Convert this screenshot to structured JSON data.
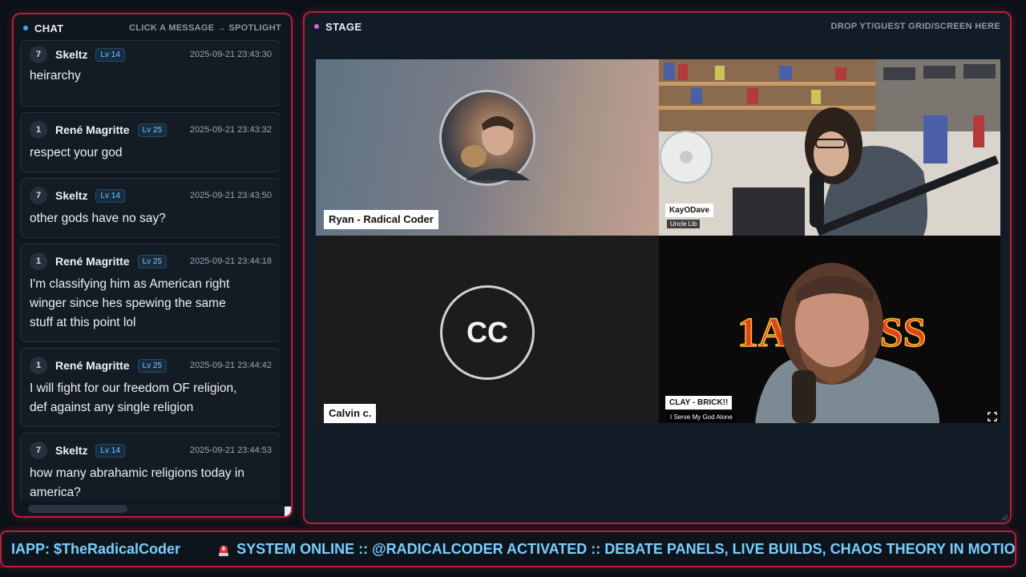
{
  "chat": {
    "title": "CHAT",
    "hint": "CLICK A MESSAGE → SPOTLIGHT",
    "messages": [
      {
        "rank": "7",
        "user": "Skeltz",
        "level": "Lv 14",
        "time": "2025-09-21 23:43:30",
        "lines": [
          "heirarchy"
        ]
      },
      {
        "rank": "1",
        "user": "René Magritte",
        "level": "Lv 25",
        "time": "2025-09-21 23:43:32",
        "lines": [
          "respect your god"
        ]
      },
      {
        "rank": "7",
        "user": "Skeltz",
        "level": "Lv 14",
        "time": "2025-09-21 23:43:50",
        "lines": [
          "other gods have no say?"
        ]
      },
      {
        "rank": "1",
        "user": "René Magritte",
        "level": "Lv 25",
        "time": "2025-09-21 23:44:18",
        "lines": [
          "I'm classifying him as American right",
          "winger since hes spewing the same",
          "stuff at this point lol"
        ]
      },
      {
        "rank": "1",
        "user": "René Magritte",
        "level": "Lv 25",
        "time": "2025-09-21 23:44:42",
        "lines": [
          "I will fight for our freedom OF religion,",
          "def against any single religion"
        ]
      },
      {
        "rank": "7",
        "user": "Skeltz",
        "level": "Lv 14",
        "time": "2025-09-21 23:44:53",
        "lines": [
          "how many abrahamic religions today in",
          "america?"
        ]
      }
    ]
  },
  "stage": {
    "title": "STAGE",
    "hint": "DROP YT/GUEST GRID/SCREEN HERE",
    "tiles": {
      "ryan": {
        "label": "Ryan - Radical Coder"
      },
      "kayo": {
        "label": "KayODave",
        "sub": "Uncle Lib"
      },
      "calvin": {
        "label": "Calvin c.",
        "initials": "CC"
      },
      "clay": {
        "label": "CLAY - BRICK!!",
        "sub": "I Serve My God Alone",
        "backdrop": "1A PRESS"
      }
    }
  },
  "ticker": {
    "left_text": "IAPP: $TheRadicalCoder",
    "main_text": "SYSTEM ONLINE :: @RADICALCODER ACTIVATED :: DEBATE PANELS, LIVE BUILDS, CHAOS THEORY IN MOTION"
  },
  "colors": {
    "accent_border": "#b3213a",
    "ticker_text": "#78cfff",
    "level_badge": "#74c8ff"
  }
}
